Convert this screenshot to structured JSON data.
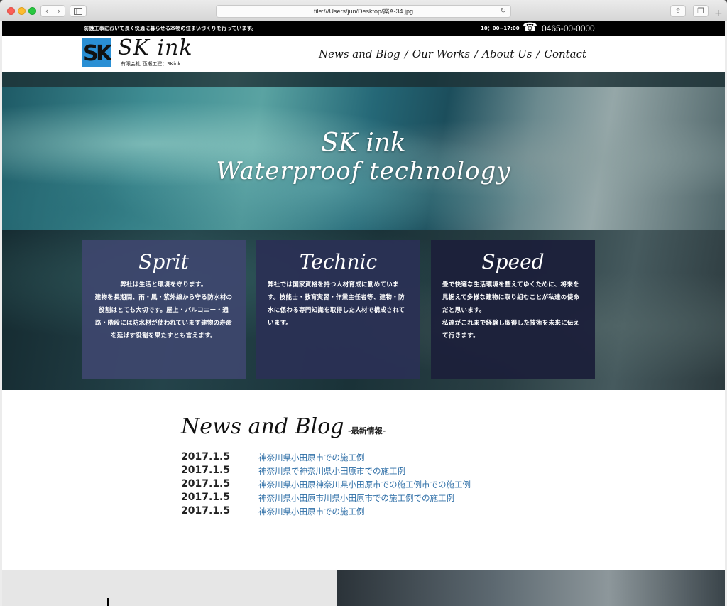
{
  "browser": {
    "address": "file:///Users/jun/Desktop/案A-34.jpg"
  },
  "topbar": {
    "tagline": "防護工事において長く快適に暮らせる本物の住まいづくりを行っています。",
    "hours": "10：00~17:00",
    "phone": "0465-00-0000"
  },
  "header": {
    "logo_text": "SK ink",
    "logo_sub": "有限会社 西瀬工建：SKink",
    "nav": [
      "News and Blog",
      "Our Works",
      "About Us",
      "Contact"
    ],
    "nav_sep": "/"
  },
  "hero": {
    "line1": "SK ink",
    "line2": "Waterproof technology"
  },
  "cards": [
    {
      "title": "Sprit",
      "text": "弊社は生活と環境を守ります。\n建物を長期間、雨・風・紫外線から守る防水材の役割はとても大切です。屋上・バルコニー・通路・階段には防水材が使われています建物の寿命を延ばす役割を果たすとも言えます。"
    },
    {
      "title": "Technic",
      "text": "弊社では国家資格を持つ人材育成に勤めています。技能士・教育実習・作業主任者等、建物・防水に係わる専門知識を取得した人材で構成されています。"
    },
    {
      "title": "Speed",
      "text": "畳で快適な生活環境を整えてゆくために、将来を見据えて多様な建物に取り組むことが私達の使命だと思います。\n私達がこれまで経験し取得した技術を未来に伝えて行きます。"
    }
  ],
  "news": {
    "heading": "News and Blog",
    "sub": "-最新情報-",
    "items": [
      {
        "date": "2017.1.5",
        "title": "神奈川県小田原市での施工例"
      },
      {
        "date": "2017.1.5",
        "title": "神奈川県で神奈川県小田原市での施工例"
      },
      {
        "date": "2017.1.5",
        "title": "神奈川県小田原神奈川県小田原市での施工例市での施工例"
      },
      {
        "date": "2017.1.5",
        "title": "神奈川県小田原市川県小田原市での施工例での施工例"
      },
      {
        "date": "2017.1.5",
        "title": "神奈川県小田原市での施工例"
      }
    ]
  },
  "colors": {
    "link": "#2f6fa7",
    "logo_blue": "#2a8fd4",
    "card1": "#3e466e",
    "card2": "#2a3054",
    "card3": "#1c203a"
  }
}
